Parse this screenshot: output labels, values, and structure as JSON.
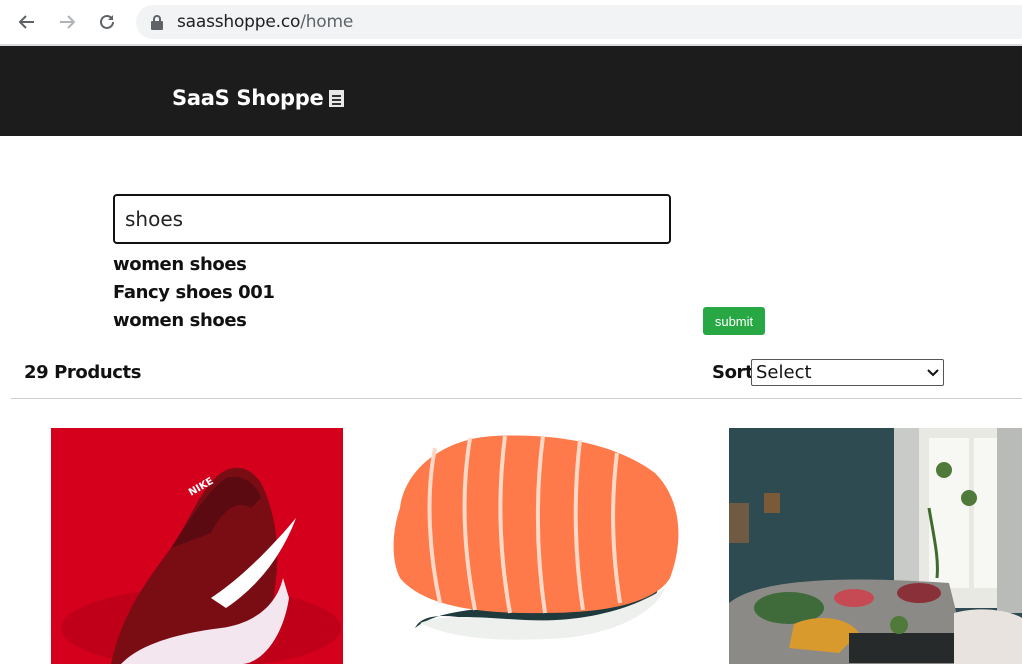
{
  "browser": {
    "url_host": "saasshoppe.co",
    "url_path": "/home"
  },
  "header": {
    "brand": "SaaS Shoppe"
  },
  "search": {
    "value": "shoes",
    "suggestions": [
      "women shoes",
      "Fancy shoes 001",
      "women shoes"
    ],
    "submit_label": "submit"
  },
  "products_bar": {
    "count_label": "29 Products",
    "sort_label": "Sort",
    "sort_selected": "Select"
  },
  "products": [
    {
      "image": "red-sneaker"
    },
    {
      "image": "salmon-sushi"
    },
    {
      "image": "living-room"
    }
  ],
  "colors": {
    "header_bg": "#1c1c1c",
    "submit_bg": "#28a745"
  }
}
